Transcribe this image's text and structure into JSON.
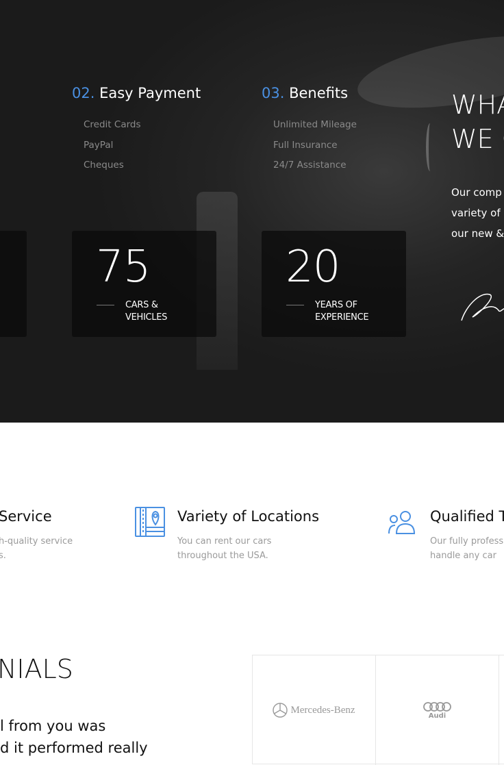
{
  "colors": {
    "accent": "#4a90e2",
    "dark_bg": "#1c1c1c"
  },
  "columns": [
    {
      "num": "02.",
      "title": "Easy Payment",
      "items": [
        "Credit Cards",
        "PayPal",
        "Cheques"
      ]
    },
    {
      "num": "03.",
      "title": "Benefits",
      "items": [
        "Unlimited Mileage",
        "Full Insurance",
        "24/7 Assistance"
      ]
    }
  ],
  "stats": [
    {
      "value": "75",
      "label_line1": "Cars &",
      "label_line2": "Vehicles"
    },
    {
      "value": "20",
      "label_line1": "Years of",
      "label_line2": "Experience"
    }
  ],
  "about": {
    "title_line1": "WHA",
    "title_line2": "WE C",
    "text_lines": [
      "Our comp",
      "variety of",
      "our new &"
    ]
  },
  "features": [
    {
      "title": "Service",
      "text_lines": [
        "h-quality service",
        "s."
      ]
    },
    {
      "icon": "map-location-icon",
      "title": "Variety of Locations",
      "text_lines": [
        "You can rent our cars",
        "throughout the USA."
      ]
    },
    {
      "icon": "users-icon",
      "title": "Qualified T",
      "text_lines": [
        "Our fully profess",
        "handle any car"
      ]
    }
  ],
  "testimonials": {
    "title": "NIALS",
    "text_lines": [
      "l from you was",
      "d it performed really"
    ]
  },
  "brands": [
    {
      "name": "Mercedes-Benz"
    },
    {
      "name": "Audi"
    }
  ]
}
